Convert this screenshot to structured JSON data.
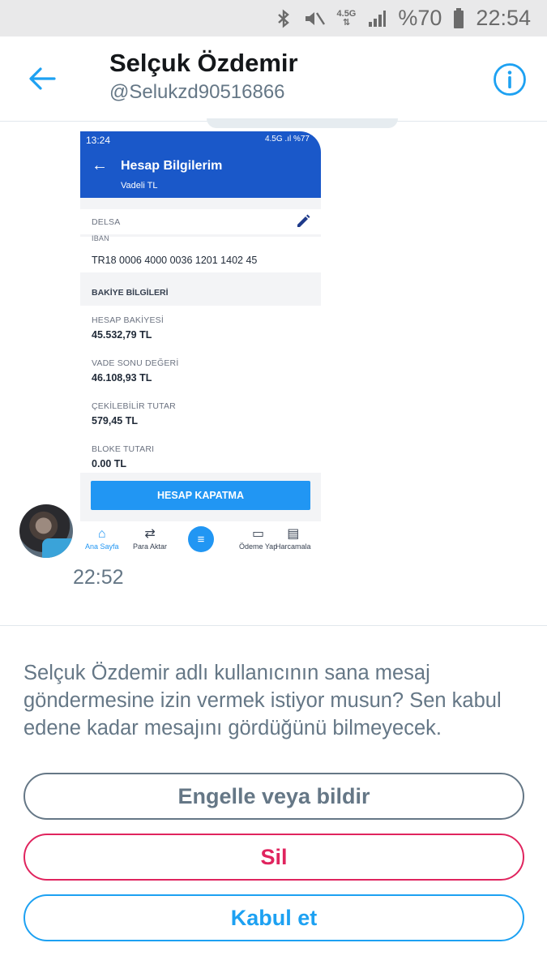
{
  "status_bar": {
    "network": "4.5G",
    "battery": "%70",
    "time": "22:54"
  },
  "header": {
    "name": "Selçuk Özdemir",
    "handle": "@Selukzd90516866"
  },
  "message": {
    "time": "22:52",
    "attached_screenshot": {
      "status_time": "13:24",
      "status_right": "4.5G .ıl %77",
      "title": "Hesap Bilgilerim",
      "subtitle": "Vadeli TL",
      "account_name": "DELSA",
      "iban_label": "IBAN",
      "iban": "TR18 0006 4000 0036 1201 1402 45",
      "section_title": "BAKİYE BİLGİLERİ",
      "fields": [
        {
          "label": "HESAP BAKİYESİ",
          "value": "45.532,79 TL"
        },
        {
          "label": "VADE SONU DEĞERİ",
          "value": "46.108,93 TL"
        },
        {
          "label": "ÇEKİLEBİLİR TUTAR",
          "value": "579,45 TL"
        },
        {
          "label": "BLOKE TUTARI",
          "value": "0.00 TL"
        }
      ],
      "close_button": "HESAP KAPATMA",
      "tabs": [
        "Ana Sayfa",
        "Para Aktar",
        "Ödeme Yap",
        "Harcamala"
      ]
    }
  },
  "prompt": "Selçuk Özdemir adlı kullanıcının sana mesaj göndermesine izin vermek istiyor musun? Sen kabul edene kadar mesajını gördüğünü bilmeyecek.",
  "actions": {
    "block": "Engelle veya bildir",
    "delete": "Sil",
    "accept": "Kabul et"
  },
  "colors": {
    "accent": "#1da1f2",
    "danger": "#e0245e",
    "muted": "#657786",
    "bank_blue": "#1a58c9"
  }
}
